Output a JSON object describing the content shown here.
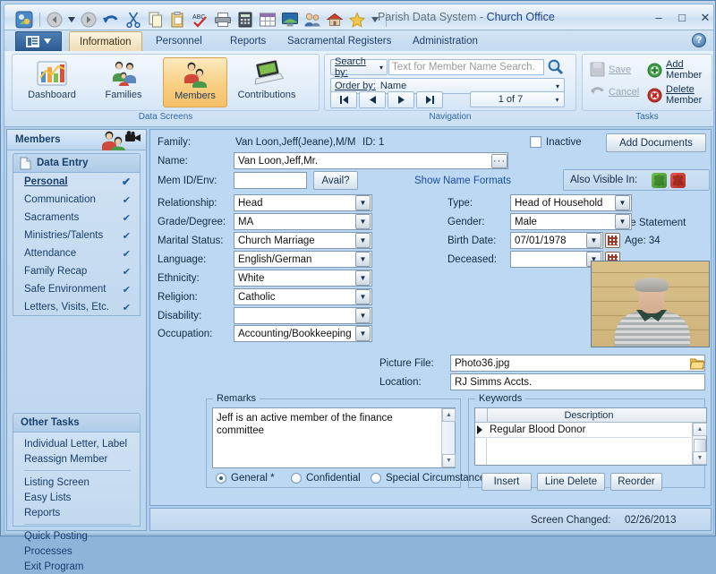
{
  "window": {
    "title_prefix": "Parish Data System - ",
    "title_app": "Church Office",
    "minimize": "–",
    "maximize": "□",
    "close": "✕"
  },
  "quick_access": {
    "items": [
      {
        "name": "app-logo-icon",
        "glyph": "❖"
      },
      {
        "name": "back-icon",
        "glyph": "◀"
      },
      {
        "name": "back-dropdown-icon",
        "glyph": "▾"
      },
      {
        "name": "forward-icon",
        "glyph": "▶"
      },
      {
        "name": "undo-icon",
        "glyph": "↶"
      },
      {
        "name": "cut-icon",
        "glyph": "✂"
      },
      {
        "name": "copy-icon",
        "glyph": "⎘"
      },
      {
        "name": "paste-icon",
        "glyph": "Ὄb"
      },
      {
        "name": "spellcheck-icon",
        "glyph": "ABC"
      },
      {
        "name": "print-icon",
        "glyph": "⎙"
      },
      {
        "name": "calculator-icon",
        "glyph": "▦"
      },
      {
        "name": "table-icon",
        "glyph": "▤"
      },
      {
        "name": "monitor-icon",
        "glyph": "▭"
      },
      {
        "name": "people-icon",
        "glyph": "☻"
      },
      {
        "name": "home-icon",
        "glyph": "⌂"
      },
      {
        "name": "favorite-icon",
        "glyph": "★"
      },
      {
        "name": "more-icon",
        "glyph": "▾"
      }
    ]
  },
  "menu": {
    "app_button": "☰",
    "app_button_arrow": "▾",
    "tabs": [
      {
        "label": "Information",
        "active": true
      },
      {
        "label": "Personnel",
        "active": false
      },
      {
        "label": "Reports",
        "active": false
      },
      {
        "label": "Sacramental Registers",
        "active": false
      },
      {
        "label": "Administration",
        "active": false
      }
    ],
    "help": "?"
  },
  "ribbon": {
    "data_screens": {
      "caption": "Data Screens",
      "buttons": [
        {
          "label": "Dashboard",
          "icon": "chart-icon",
          "selected": false
        },
        {
          "label": "Families",
          "icon": "families-icon",
          "selected": false
        },
        {
          "label": "Members",
          "icon": "members-icon",
          "selected": true
        },
        {
          "label": "Contributions",
          "icon": "laptop-icon",
          "selected": false
        }
      ]
    },
    "navigation": {
      "caption": "Navigation",
      "search_by_label": "Search by:",
      "search_by_arrow": "▾",
      "search_placeholder": "Text for Member Name Search.",
      "search_value": "",
      "search_icon": "magnifier-icon",
      "order_by_label": "Order by:",
      "order_by_value": "Name",
      "order_by_arrow": "▾",
      "nav_first": "⏮",
      "nav_prev": "◀",
      "nav_next": "▶",
      "nav_last": "⏭",
      "record_counter": "1 of 7",
      "record_counter_arrow": "▾"
    },
    "tasks": {
      "caption": "Tasks",
      "save_label": "Save",
      "cancel_label": "Cancel",
      "add_label_line1": "Add",
      "add_label_line2": "Member",
      "delete_label_line1": "Delete",
      "delete_label_line2": "Member"
    }
  },
  "sidebar": {
    "header": "Members",
    "data_entry": {
      "title": "Data Entry",
      "items": [
        {
          "label": "Personal",
          "checked": true,
          "current": true
        },
        {
          "label": "Communication",
          "checked": true,
          "current": false
        },
        {
          "label": "Sacraments",
          "checked": true,
          "current": false
        },
        {
          "label": "Ministries/Talents",
          "checked": true,
          "current": false
        },
        {
          "label": "Attendance",
          "checked": true,
          "current": false
        },
        {
          "label": "Family Recap",
          "checked": true,
          "current": false
        },
        {
          "label": "Safe Environment",
          "checked": true,
          "current": false
        },
        {
          "label": "Letters, Visits, Etc.",
          "checked": true,
          "current": false
        }
      ]
    },
    "other_tasks": {
      "title": "Other Tasks",
      "group1": [
        "Individual Letter, Label",
        "Reassign Member"
      ],
      "group2": [
        "Listing Screen",
        "Easy Lists",
        "Reports"
      ],
      "group3": [
        "Quick Posting",
        "Processes",
        "Exit Program"
      ]
    },
    "checkmark": "✔"
  },
  "form": {
    "family_label": "Family:",
    "family_value": "Van Loon,Jeff(Jeane),M/M",
    "id_label": "ID: 1",
    "name_label": "Name:",
    "name_value": "Van Loon,Jeff,Mr.",
    "name_dots": "···",
    "mem_id_label": "Mem ID/Env:",
    "mem_id_value": "",
    "avail_button": "Avail?",
    "show_name_formats": "Show Name Formats",
    "inactive_label": "Inactive",
    "inactive_checked": false,
    "add_documents_button": "Add Documents",
    "also_visible_label": "Also Visible In:",
    "separate_statement_label": "Separate Statement",
    "separate_statement_checked": false,
    "fields_left": [
      {
        "label": "Relationship:",
        "value": "Head"
      },
      {
        "label": "Grade/Degree:",
        "value": "MA"
      },
      {
        "label": "Marital Status:",
        "value": "Church Marriage"
      },
      {
        "label": "Language:",
        "value": "English/German"
      },
      {
        "label": "Ethnicity:",
        "value": "White"
      },
      {
        "label": "Religion:",
        "value": "Catholic"
      },
      {
        "label": "Disability:",
        "value": ""
      },
      {
        "label": "Occupation:",
        "value": "Accounting/Bookkeeping"
      }
    ],
    "type_label": "Type:",
    "type_value": "Head of Household",
    "gender_label": "Gender:",
    "gender_value": "Male",
    "birth_date_label": "Birth Date:",
    "birth_date_value": "07/01/1978",
    "age_label": "Age: 34",
    "deceased_label": "Deceased:",
    "deceased_value": "",
    "picture_file_label": "Picture File:",
    "picture_file_value": "Photo36.jpg",
    "location_label": "Location:",
    "location_value": "RJ Simms Accts.",
    "remarks": {
      "caption": "Remarks",
      "text": "Jeff is an active member of the finance committee",
      "radios": [
        {
          "label": "General *",
          "selected": true
        },
        {
          "label": "Confidential",
          "selected": false
        },
        {
          "label": "Special Circumstances",
          "selected": false
        }
      ]
    },
    "keywords": {
      "caption": "Keywords",
      "column_header": "Description",
      "rows": [
        "Regular Blood Donor"
      ],
      "insert_button": "Insert",
      "line_delete_button": "Line Delete",
      "reorder_button": "Reorder"
    },
    "status": {
      "screen_changed_label": "Screen Changed:",
      "screen_changed_date": "02/26/2013"
    }
  },
  "colors": {
    "titlebar_app": "#1c3f8f",
    "accent_tab": "#f0dcb4",
    "link": "#1c4ea0",
    "group_caption": "#2f6ba8",
    "add_green": "#2f9b3f",
    "delete_red": "#c9322c"
  }
}
